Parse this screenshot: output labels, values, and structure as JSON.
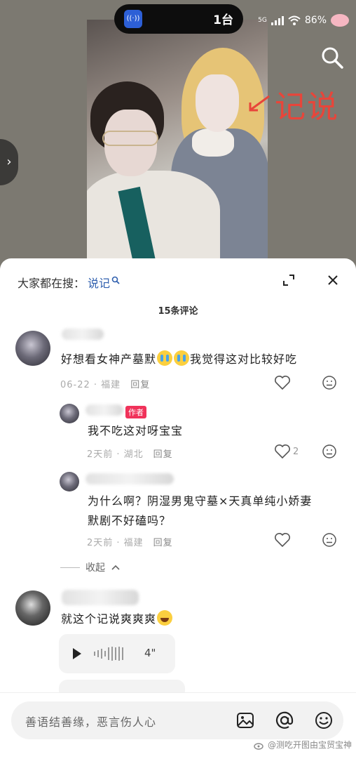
{
  "status_bar": {
    "cast_badge": "((·))",
    "cast_count": "1台",
    "network": "5G",
    "battery": "86%"
  },
  "video": {
    "annotation": "记说",
    "side_arrow": "›"
  },
  "sheet": {
    "trending_prefix": "大家都在搜：",
    "trending_keyword": "说记",
    "comment_count": "15条评论",
    "comments": [
      {
        "text_a": "好想看女神产墓默",
        "text_b": "我觉得这对比较好吃",
        "date": "06-22 · 福建",
        "reply": "回复"
      },
      {
        "badge": "作者",
        "text": "我不吃这对呀宝宝",
        "date": "2天前 · 湖北",
        "reply": "回复",
        "likes": "2"
      },
      {
        "text_line1": "为什么啊？阴湿男鬼守墓×天真单纯小娇妻",
        "text_line2": "默剧不好磕吗？",
        "date": "2天前 · 福建",
        "reply": "回复"
      },
      {
        "text": "就这个记说爽爽爽",
        "voice_duration": "4\""
      }
    ],
    "collapse_label": "收起"
  },
  "input_bar": {
    "placeholder": "善语结善缘，恶言伤人心"
  },
  "watermark": "@测吃开图由宝贸宝神"
}
